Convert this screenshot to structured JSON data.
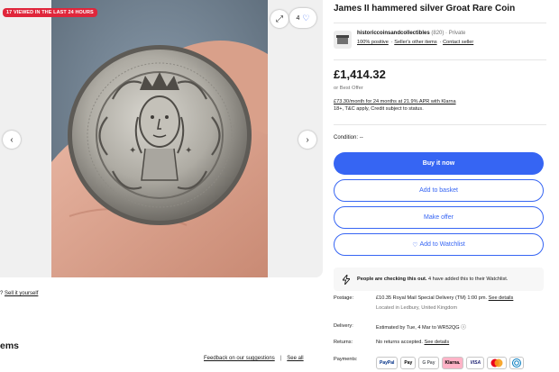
{
  "gallery": {
    "viewed_badge": "17 VIEWED IN THE LAST 24 HOURS",
    "watch_count": "4",
    "expand_icon": "expand-icon",
    "heart_icon": "heart-icon",
    "prev_icon": "chevron-left-icon",
    "next_icon": "chevron-right-icon"
  },
  "below_gallery": {
    "sell_prefix": "?",
    "sell_link": "Sell it yourself",
    "items_heading": "ems",
    "feedback_link": "Feedback on our suggestions",
    "separator": "|",
    "see_all": "See all"
  },
  "listing": {
    "title": "James II hammered silver Groat Rare Coin",
    "seller_name": "historiccoinsandcollectibles",
    "seller_score": "(820) · Private",
    "seller_positive": "100% positive",
    "seller_other_items": "Seller's other items",
    "seller_contact": "Contact seller",
    "price": "£1,414.32",
    "best_offer": "or Best Offer",
    "klarna_line": "£73.30/month for 24 months at 21.9% APR with Klarna",
    "klarna_sub": "18+, T&C apply, Credit subject to status.",
    "condition_label": "Condition:",
    "condition_value": "--"
  },
  "actions": {
    "buy_now": "Buy it now",
    "add_to_basket": "Add to basket",
    "make_offer": "Make offer",
    "add_to_watchlist": "Add to Watchlist"
  },
  "alert": {
    "bold": "People are checking this out.",
    "rest": "4 have added this to their Watchlist."
  },
  "postage": {
    "label": "Postage:",
    "value": "£10.35 Royal Mail Special Delivery (TM) 1:00 pm.",
    "link": "See details",
    "location": "Located in Ledbury, United Kingdom"
  },
  "delivery": {
    "label": "Delivery:",
    "value": "Estimated by Tue, 4 Mar to WR52QG"
  },
  "returns": {
    "label": "Returns:",
    "value": "No returns accepted.",
    "link": "See details"
  },
  "payments": {
    "label": "Payments:",
    "methods": [
      "PayPal",
      "Pay",
      "G Pay",
      "Klarna.",
      "VISA",
      "MC",
      "Diners"
    ]
  },
  "colors": {
    "primary": "#3665f3",
    "badge": "#e0263b"
  }
}
